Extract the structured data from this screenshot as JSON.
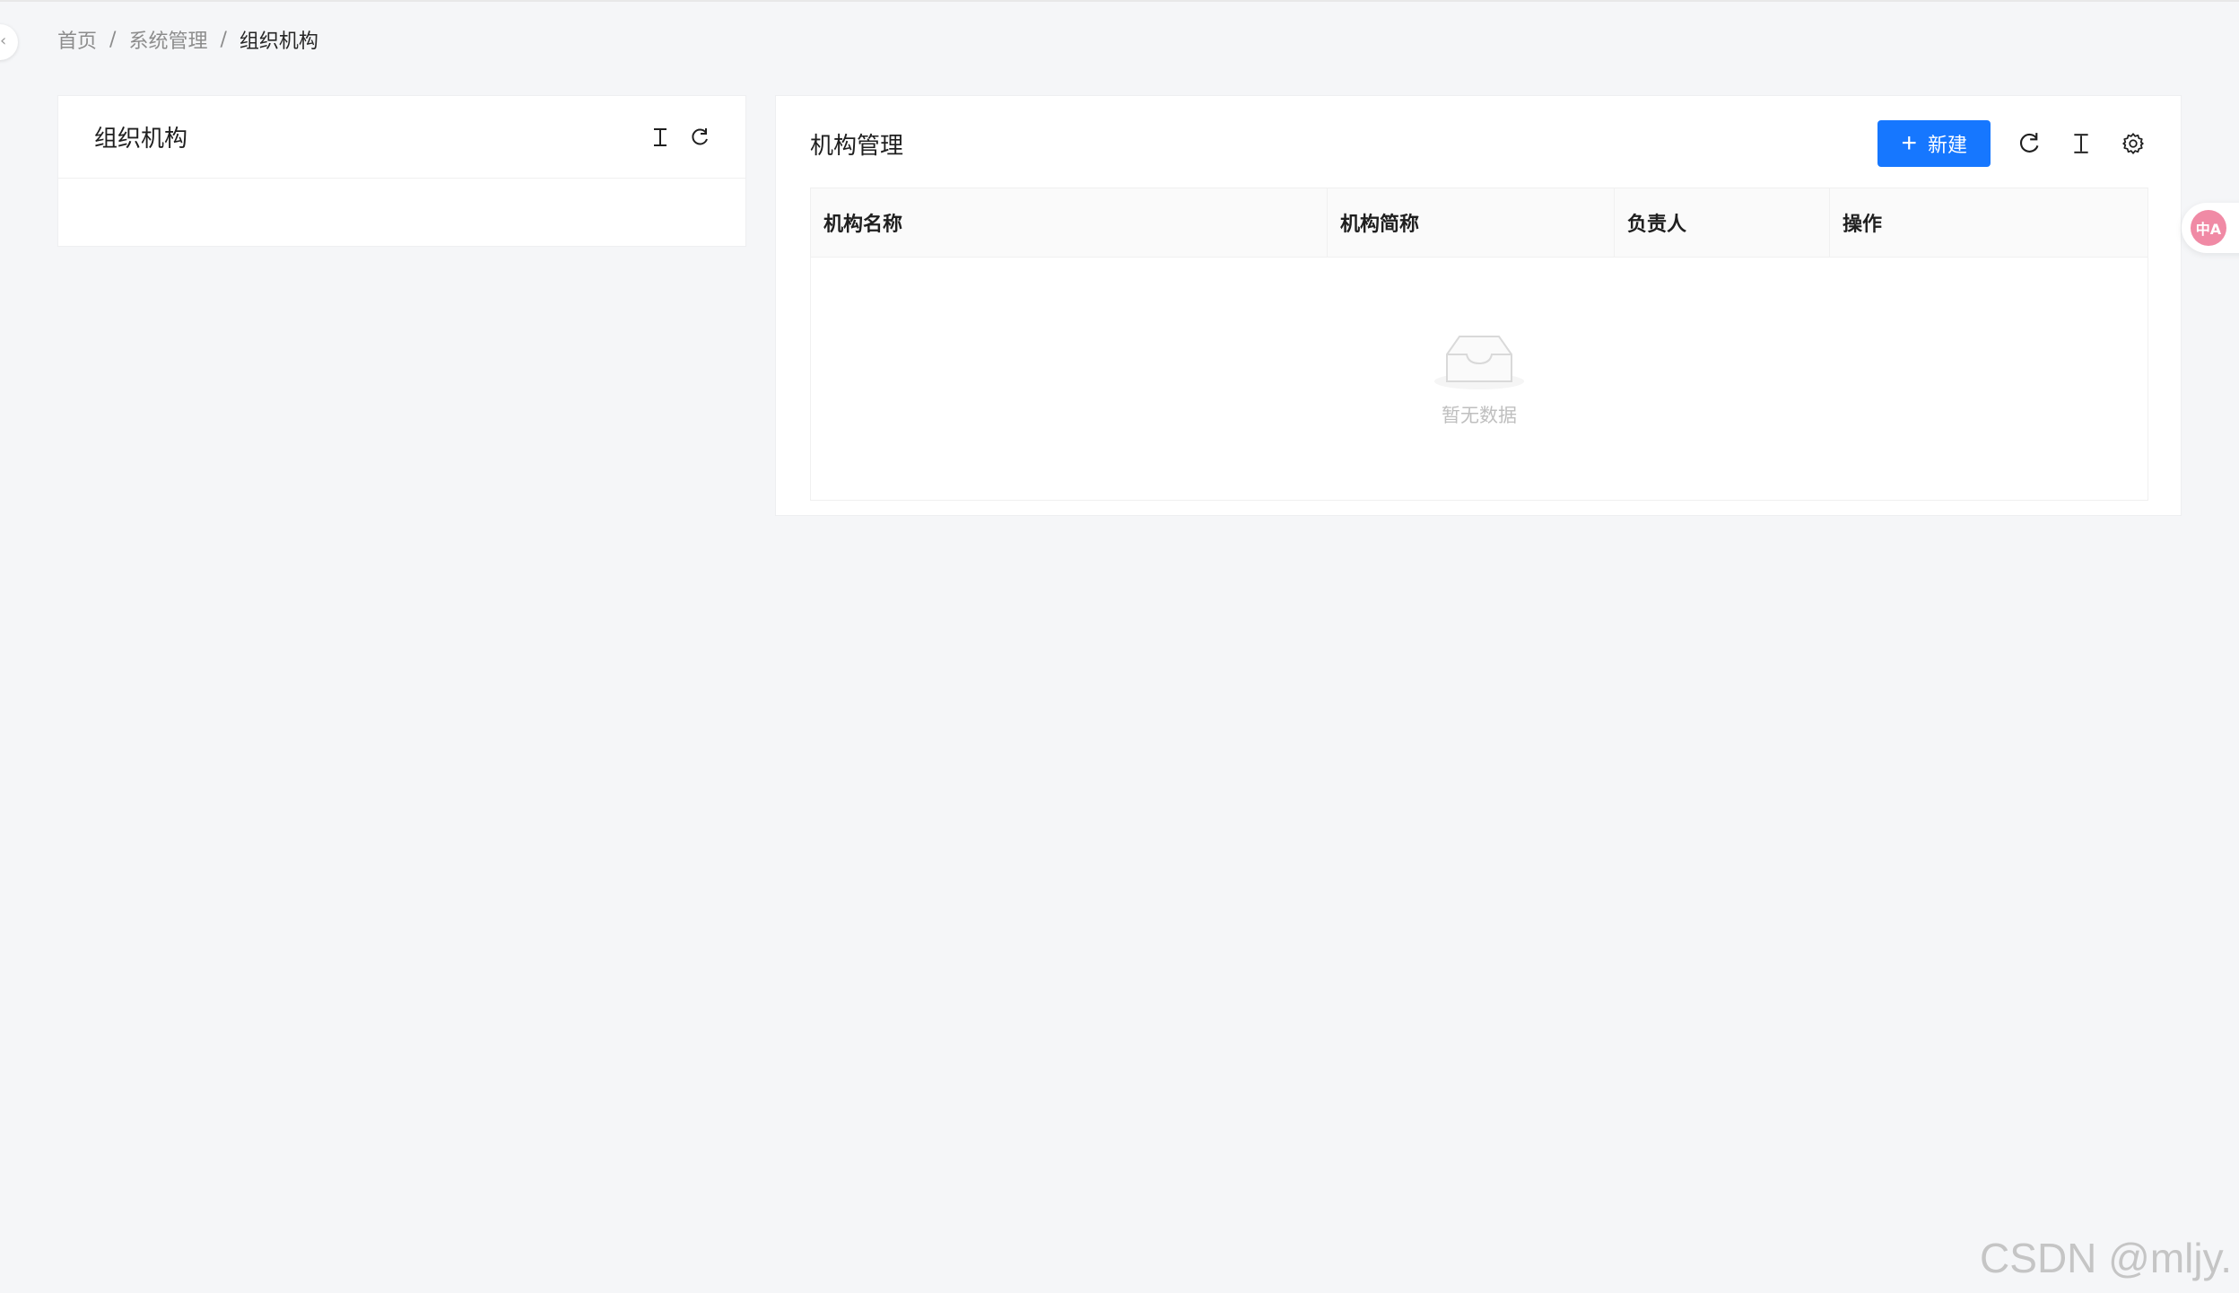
{
  "breadcrumb": {
    "items": [
      "首页",
      "系统管理",
      "组织机构"
    ],
    "separator": "/"
  },
  "left_panel": {
    "title": "组织机构",
    "icons": [
      "collapse-vertical-icon",
      "refresh-icon"
    ]
  },
  "right_panel": {
    "title": "机构管理",
    "new_button_label": "新建",
    "icons": [
      "refresh-icon",
      "column-height-icon",
      "settings-icon"
    ],
    "table": {
      "columns": [
        "机构名称",
        "机构简称",
        "负责人",
        "操作"
      ],
      "rows": [],
      "empty_text": "暂无数据"
    }
  },
  "translate_widget": {
    "label": "中A"
  },
  "watermark": "CSDN @mljy.",
  "colors": {
    "primary": "#1677ff",
    "page_background": "#f5f6f8",
    "translate_badge": "#f08aa5"
  }
}
